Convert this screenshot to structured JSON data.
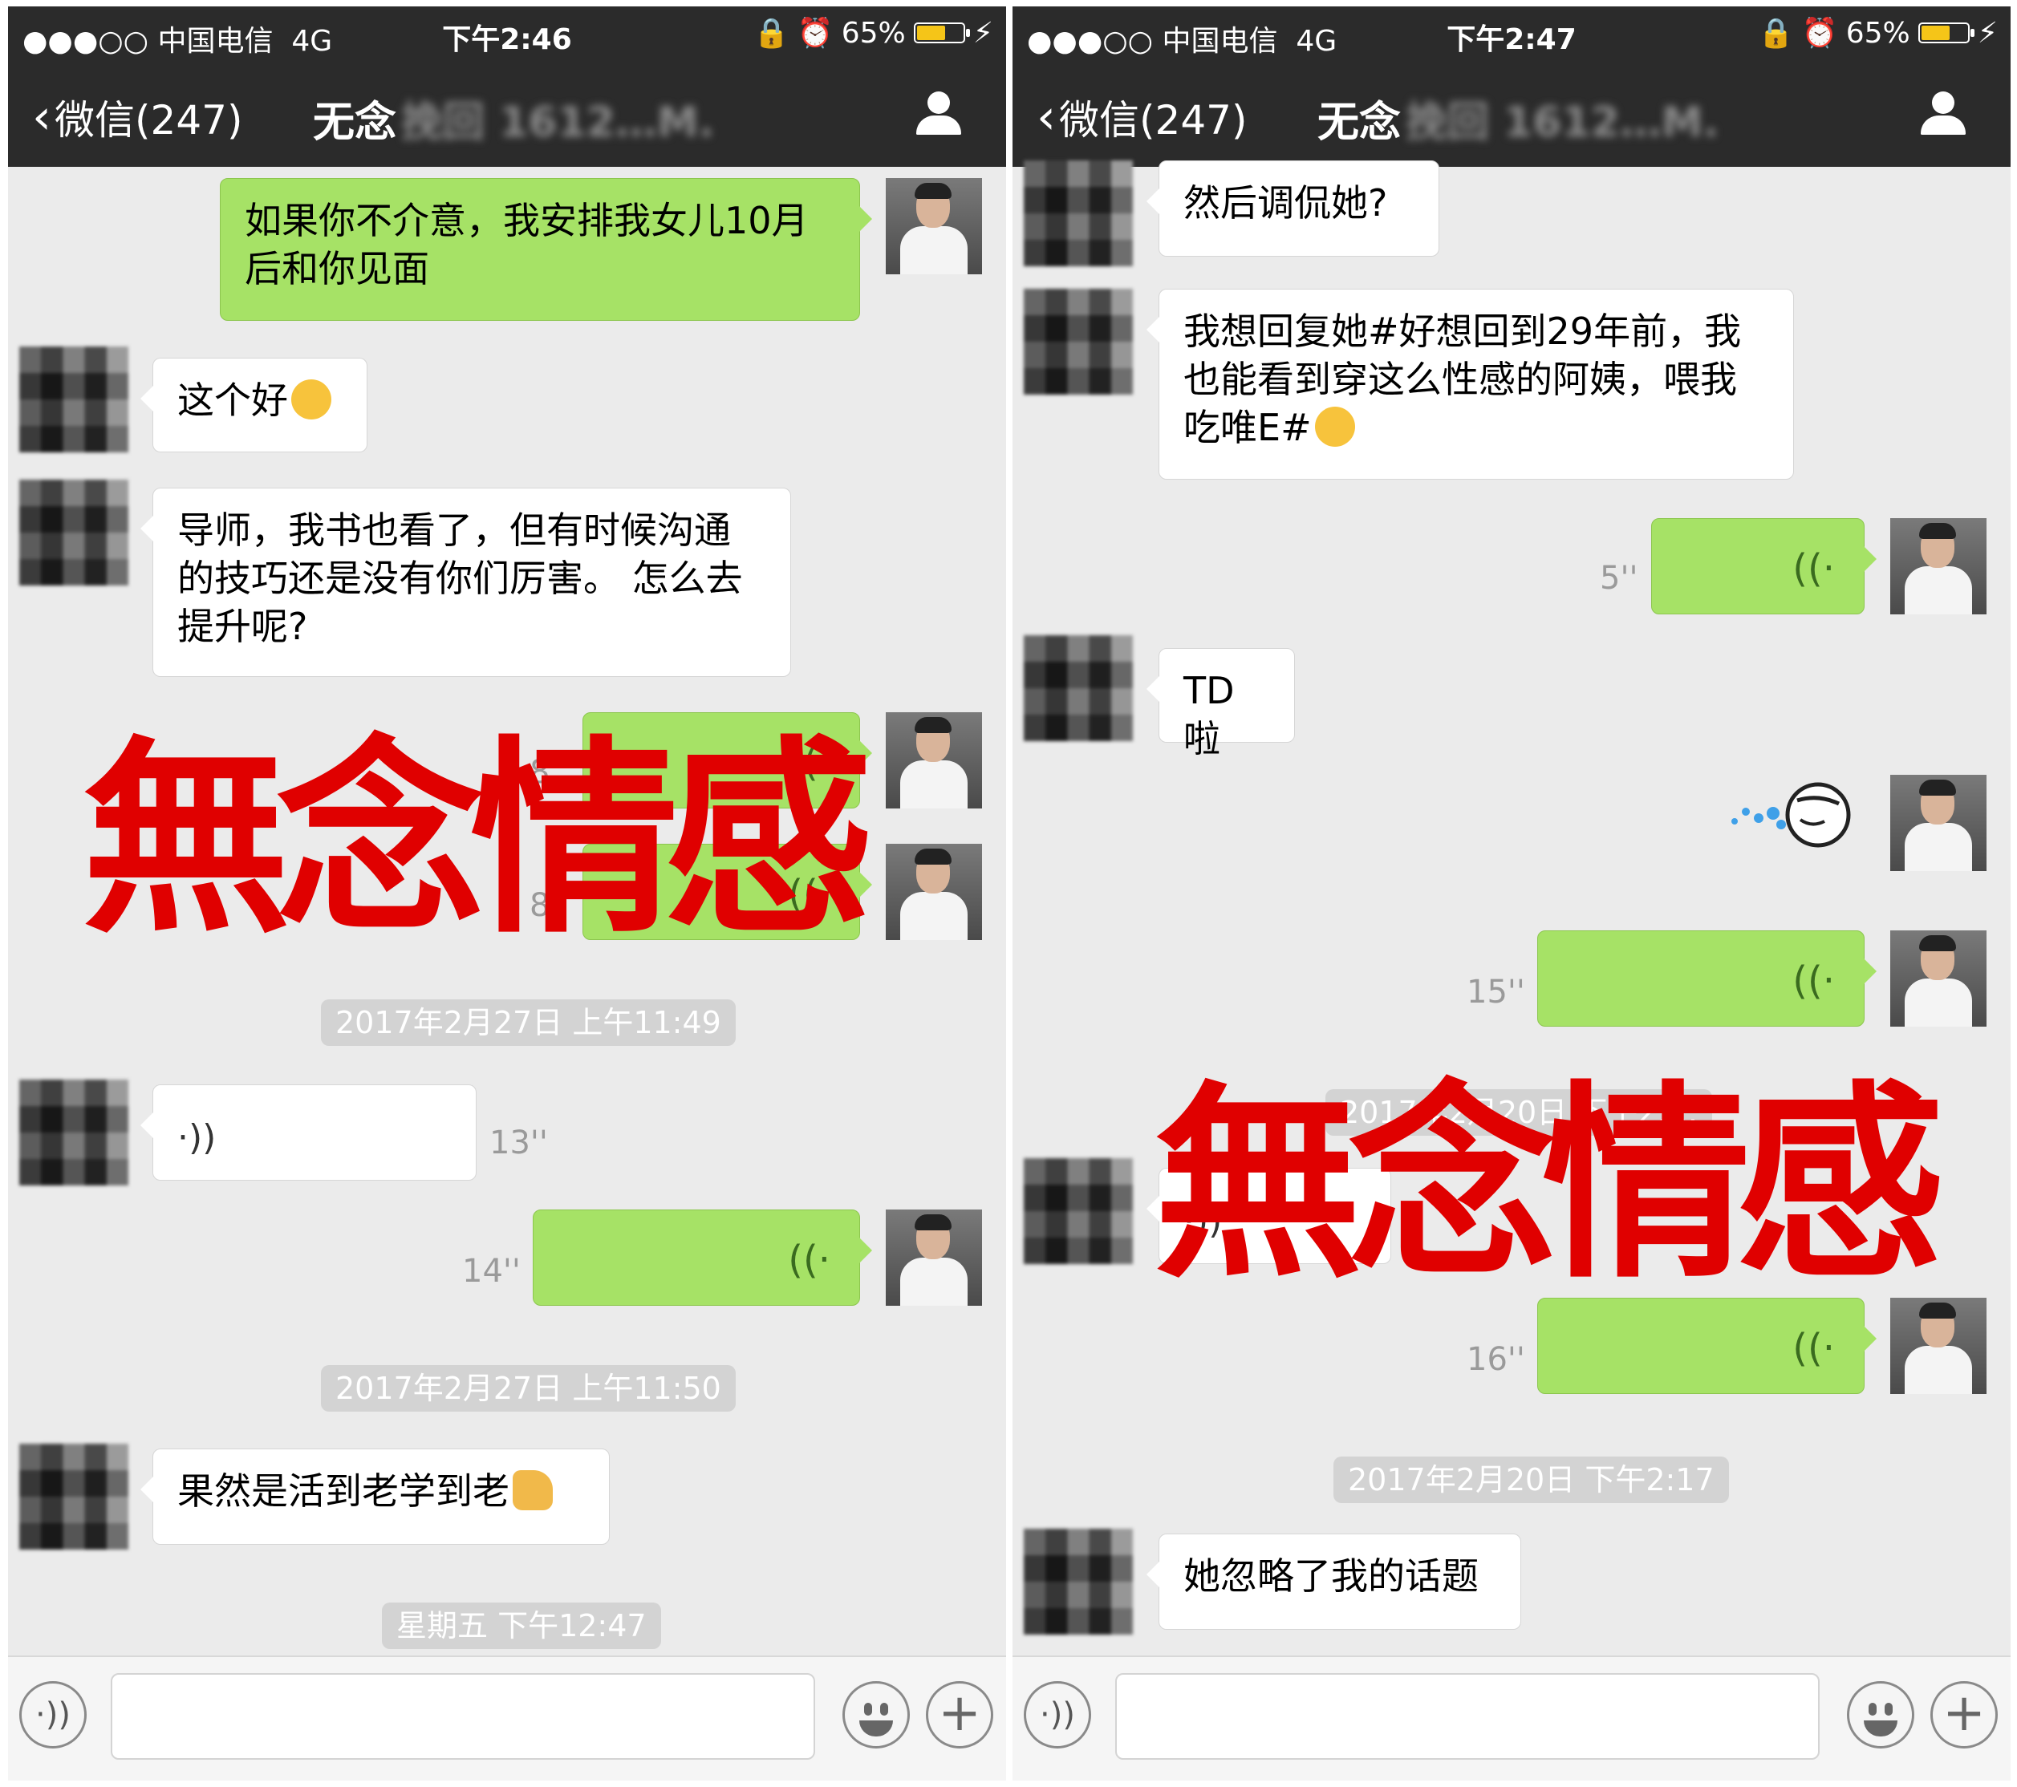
{
  "left": {
    "status": {
      "signal": "●●●○○ 中国电信  4G",
      "time": "下午2:46",
      "battery": "65%",
      "battery_level": 0.65
    },
    "nav": {
      "back_label": "微信(247)",
      "title": "无念",
      "title_blurred": "挽回 1612…M."
    },
    "messages": [
      {
        "text": "如果你不介意，我安排我女儿10月后和你见面"
      },
      {
        "text": "这个好"
      },
      {
        "text": "导师，我书也看了，但有时候沟通的技巧还是没有你们厉害。 怎么去提升呢?"
      },
      {
        "duration": "8''"
      },
      {
        "duration": "8''"
      },
      {
        "timestamp": "2017年2月27日 上午11:49"
      },
      {
        "duration": "13''"
      },
      {
        "duration": "14''"
      },
      {
        "timestamp": "2017年2月27日 上午11:50"
      },
      {
        "text": "果然是活到老学到老"
      },
      {
        "timestamp": "星期五 下午12:47"
      }
    ],
    "watermark": "無念情感"
  },
  "right": {
    "status": {
      "signal": "●●●○○ 中国电信  4G",
      "time": "下午2:47",
      "battery": "65%",
      "battery_level": 0.65
    },
    "nav": {
      "back_label": "微信(247)",
      "title": "无念",
      "title_blurred": "挽回 1612…M."
    },
    "messages": [
      {
        "text": "然后调侃她?"
      },
      {
        "text": "我想回复她#好想回到29年前，我也能看到穿这么性感的阿姨，喂我吃唯E#"
      },
      {
        "duration": "5''"
      },
      {
        "text": "TD啦"
      },
      {
        "duration": "15''"
      },
      {
        "timestamp": "2017年2月20日 下午2:…"
      },
      {
        "duration": "16''"
      },
      {
        "timestamp": "2017年2月20日 下午2:17"
      },
      {
        "text": "她忽略了我的话题"
      }
    ],
    "watermark": "無念情感"
  },
  "icons": [
    "back-chevron-icon",
    "user-icon",
    "voice-wave-icon",
    "emoji-icon",
    "plus-icon",
    "sticker-icon"
  ],
  "colors": {
    "header": "#2b2b2b",
    "background": "#ebebeb",
    "sent_bubble": "#a6e266",
    "received_bubble": "#ffffff",
    "watermark": "#e00000",
    "timestamp_bg": "#d3d3d3"
  }
}
